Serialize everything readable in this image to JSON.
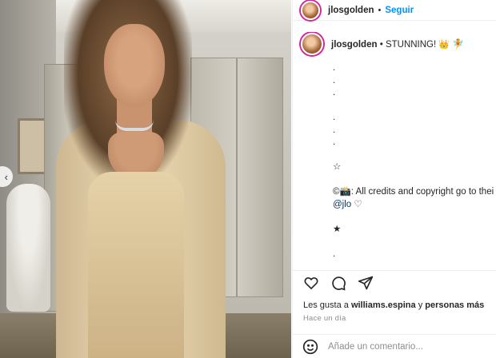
{
  "header": {
    "username": "jlosgolden",
    "separator": "•",
    "follow_label": "Seguir",
    "more_label": "···"
  },
  "caption": {
    "username": "jlosgolden",
    "bullet": "•",
    "text": "STUNNING!",
    "crown_icon": "👑",
    "fairy_icon": "🧚",
    "rows": [
      ".",
      ".",
      ".",
      "",
      ".",
      ".",
      ".",
      "",
      "☆",
      "",
      "©📸: All credits and copyright go to thei",
      "",
      "",
      "★",
      "",
      ".",
      ".",
      "."
    ],
    "mention": "@jlo",
    "mention_suffix": "♡"
  },
  "actions": {
    "like_icon": "heart-icon",
    "comment_icon": "comment-icon",
    "share_icon": "share-icon",
    "save_icon": "bookmark-icon"
  },
  "likes": {
    "prefix": "Les gusta a",
    "user": "williams.espina",
    "conjunction": "y",
    "others": "personas más"
  },
  "time": "Hace un día",
  "comment": {
    "placeholder": "Añade un comentario..."
  },
  "photo": {
    "nav_arrow": "‹"
  }
}
